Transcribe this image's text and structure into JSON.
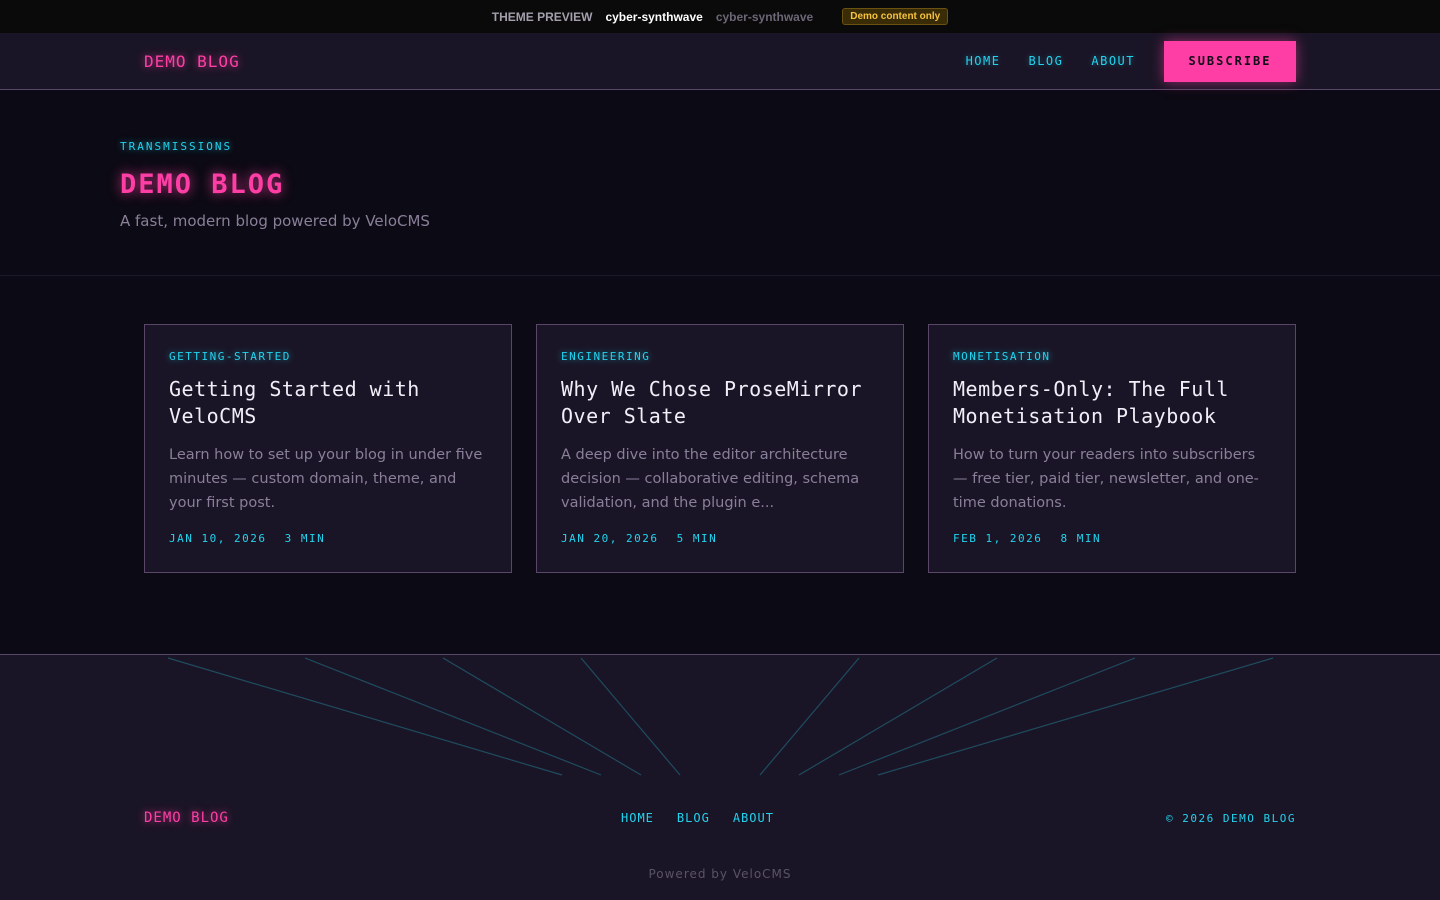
{
  "preview_bar": {
    "label": "THEME PREVIEW",
    "current_theme": "cyber-synthwave",
    "theme_select": "cyber-synthwave",
    "badge": "Demo content only"
  },
  "nav": {
    "logo": "DEMO BLOG",
    "links": [
      "HOME",
      "BLOG",
      "ABOUT"
    ],
    "subscribe": "SUBSCRIBE"
  },
  "hero": {
    "eyebrow": "TRANSMISSIONS",
    "title": "DEMO BLOG",
    "subtitle": "A fast, modern blog powered by VeloCMS"
  },
  "posts": [
    {
      "tag": "GETTING-STARTED",
      "title": "Getting Started with VeloCMS",
      "excerpt": "Learn how to set up your blog in under five minutes — custom domain, theme, and your first post.",
      "date": "JAN 10, 2026",
      "read_time": "3 MIN"
    },
    {
      "tag": "ENGINEERING",
      "title": "Why We Chose ProseMirror Over Slate",
      "excerpt": "A deep dive into the editor architecture decision — collaborative editing, schema validation, and the plugin e...",
      "date": "JAN 20, 2026",
      "read_time": "5 MIN"
    },
    {
      "tag": "MONETISATION",
      "title": "Members-Only: The Full Monetisation Playbook",
      "excerpt": "How to turn your readers into subscribers — free tier, paid tier, newsletter, and one-time donations.",
      "date": "FEB 1, 2026",
      "read_time": "8 MIN"
    }
  ],
  "footer": {
    "logo": "DEMO BLOG",
    "links": [
      "HOME",
      "BLOG",
      "ABOUT"
    ],
    "copyright": "© 2026 DEMO BLOG",
    "powered": "Powered by VeloCMS"
  },
  "colors": {
    "accent_pink": "#ff3ea5",
    "accent_cyan": "#22d3ee",
    "background": "#0c0a14",
    "surface": "#1a1526",
    "border": "#5a4668"
  }
}
